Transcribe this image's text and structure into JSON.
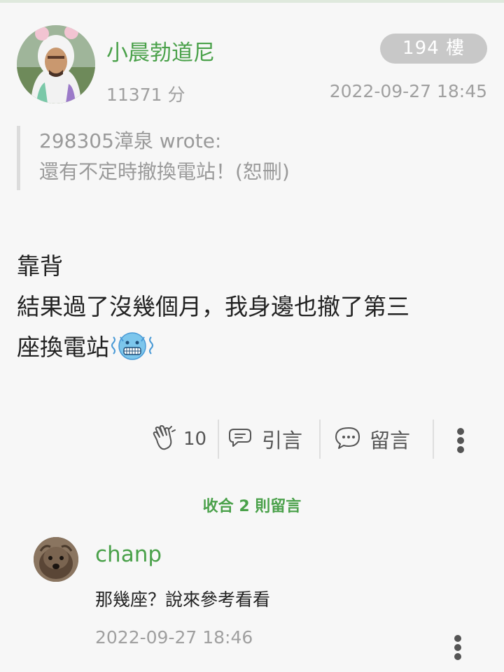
{
  "post": {
    "author": "小晨勃道尼",
    "floor": "194 樓",
    "score": "11371 分",
    "timestamp": "2022-09-27 18:45",
    "quote": {
      "line1": "298305漳泉 wrote:",
      "line2": "還有不定時撤換電站！(恕刪)"
    },
    "body": {
      "line1": "靠背",
      "line2": "結果過了沒幾個月，我身邊也撤了第三",
      "line3": "座換電站"
    },
    "emoji": "cold-face-emoji-icon"
  },
  "actions": {
    "like_count": "10",
    "quote_label": "引言",
    "comment_label": "留言"
  },
  "comments": {
    "collapse_label": "收合 2 則留言",
    "items": [
      {
        "author": "chanp",
        "text": "那幾座？說來參考看看",
        "timestamp": "2022-09-27 18:46"
      }
    ]
  },
  "colors": {
    "accent": "#4aa14a",
    "meta": "#a0a0a0",
    "badge": "#c8c8c8",
    "background": "#f7f7f7"
  }
}
